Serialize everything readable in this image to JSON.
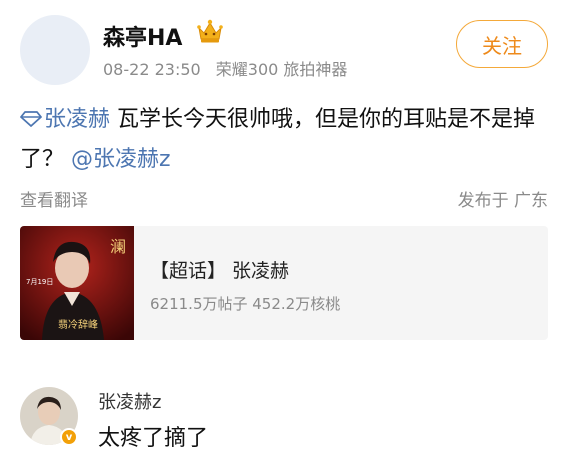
{
  "post": {
    "username": "森亭HA",
    "timestamp": "08-22 23:50",
    "device": "荣耀300 旅拍神器",
    "follow_label": "关注",
    "topic": "张凌赫",
    "text_main": " 瓦学长今天很帅哦，但是你的耳贴是不是掉了？",
    "mention": "@张凌赫z",
    "translate_label": "查看翻译",
    "location": "发布于 广东"
  },
  "super_topic_card": {
    "title": "【超话】 张凌赫",
    "stats": "6211.5万帖子 452.2万核桃",
    "thumb_poster_title": "澜",
    "thumb_date": "7月19日",
    "thumb_sub": "翡冷辞峰"
  },
  "comment": {
    "username": "张凌赫z",
    "text": "太疼了摘了"
  },
  "colors": {
    "link": "#4d76b1",
    "follow": "#ee8a1b",
    "meta": "#8a8a8a"
  }
}
